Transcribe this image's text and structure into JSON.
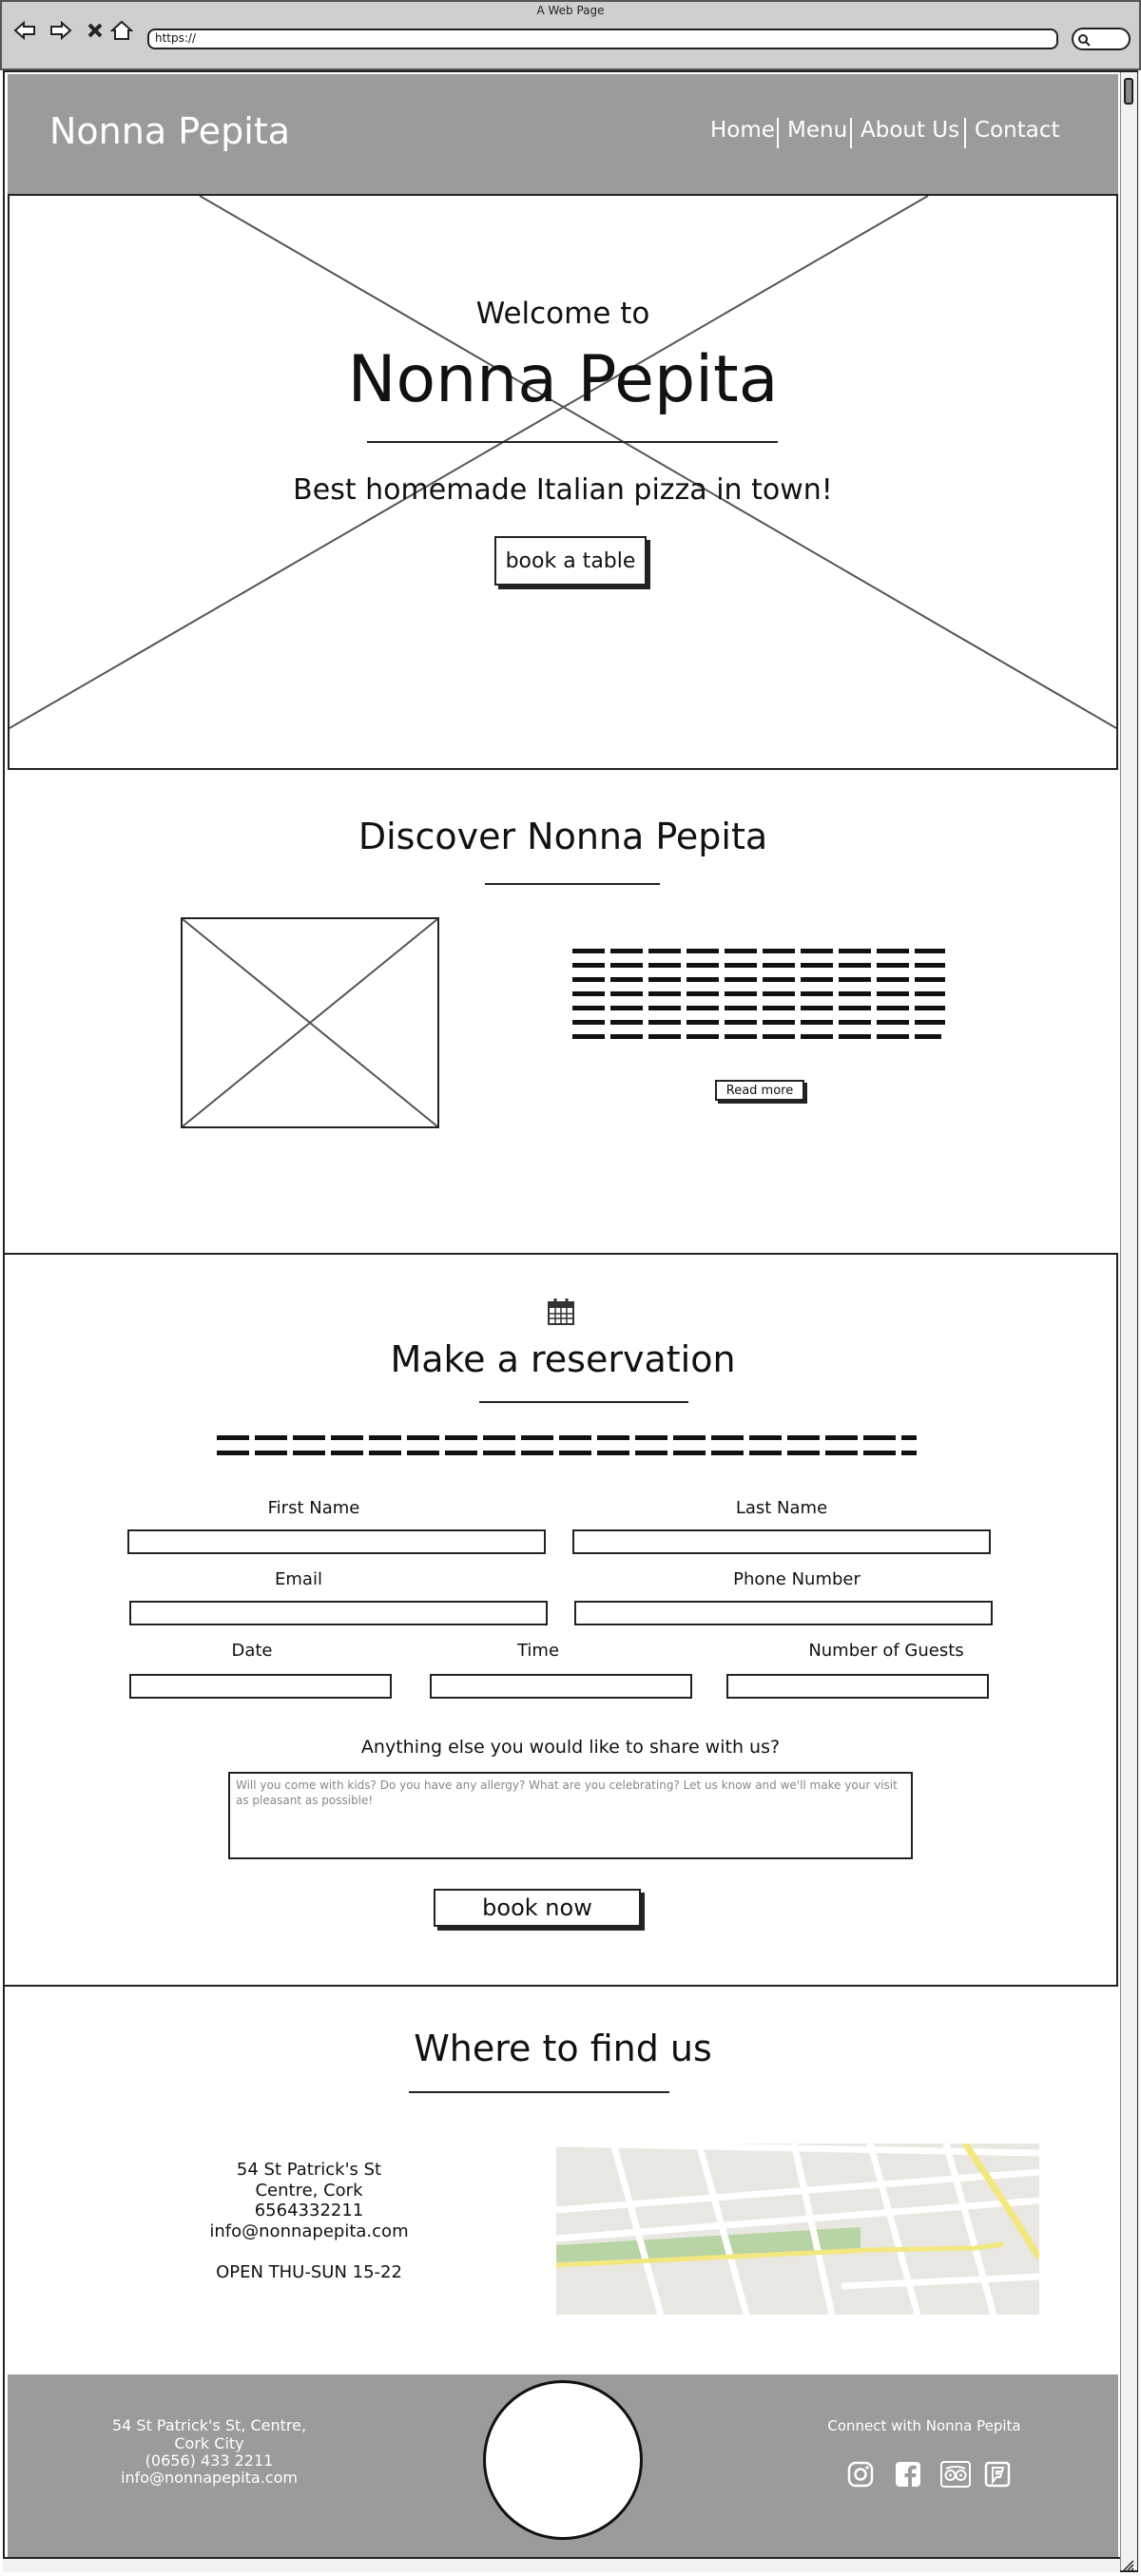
{
  "browser": {
    "window_title": "A Web Page",
    "url": "https://"
  },
  "header": {
    "brand": "Nonna Pepita",
    "nav": [
      "Home",
      "Menu",
      "About Us",
      "Contact"
    ]
  },
  "hero": {
    "welcome": "Welcome to",
    "title": "Nonna Pepita",
    "tagline": "Best homemade Italian pizza in town!",
    "cta": "book a table"
  },
  "discover": {
    "title": "Discover Nonna Pepita",
    "read_more": "Read more"
  },
  "reservation": {
    "icon": "calendar-icon",
    "title": "Make a reservation",
    "labels": {
      "first_name": "First Name",
      "last_name": "Last Name",
      "email": "Email",
      "phone": "Phone Number",
      "date": "Date",
      "time": "Time",
      "guests": "Number of Guests",
      "notes": "Anything else you would like to share with us?"
    },
    "notes_placeholder": "Will you come with kids? Do you have any allergy? What are you celebrating? Let us know and we'll make your visit as pleasant as possible!",
    "submit": "book now"
  },
  "location": {
    "title": "Where to find us",
    "address_line1": "54 St Patrick's St",
    "address_line2": "Centre, Cork",
    "phone": "6564332211",
    "email": "info@nonnapepita.com",
    "hours": "OPEN THU-SUN 15-22"
  },
  "footer": {
    "address_line1": "54 St Patrick's St, Centre,",
    "address_line2": "Cork City",
    "phone": "(0656) 433 2211",
    "email": "info@nonnapepita.com",
    "connect": "Connect with Nonna Pepita",
    "social_icons": [
      "instagram-icon",
      "facebook-icon",
      "tripadvisor-icon",
      "foursquare-icon"
    ]
  }
}
